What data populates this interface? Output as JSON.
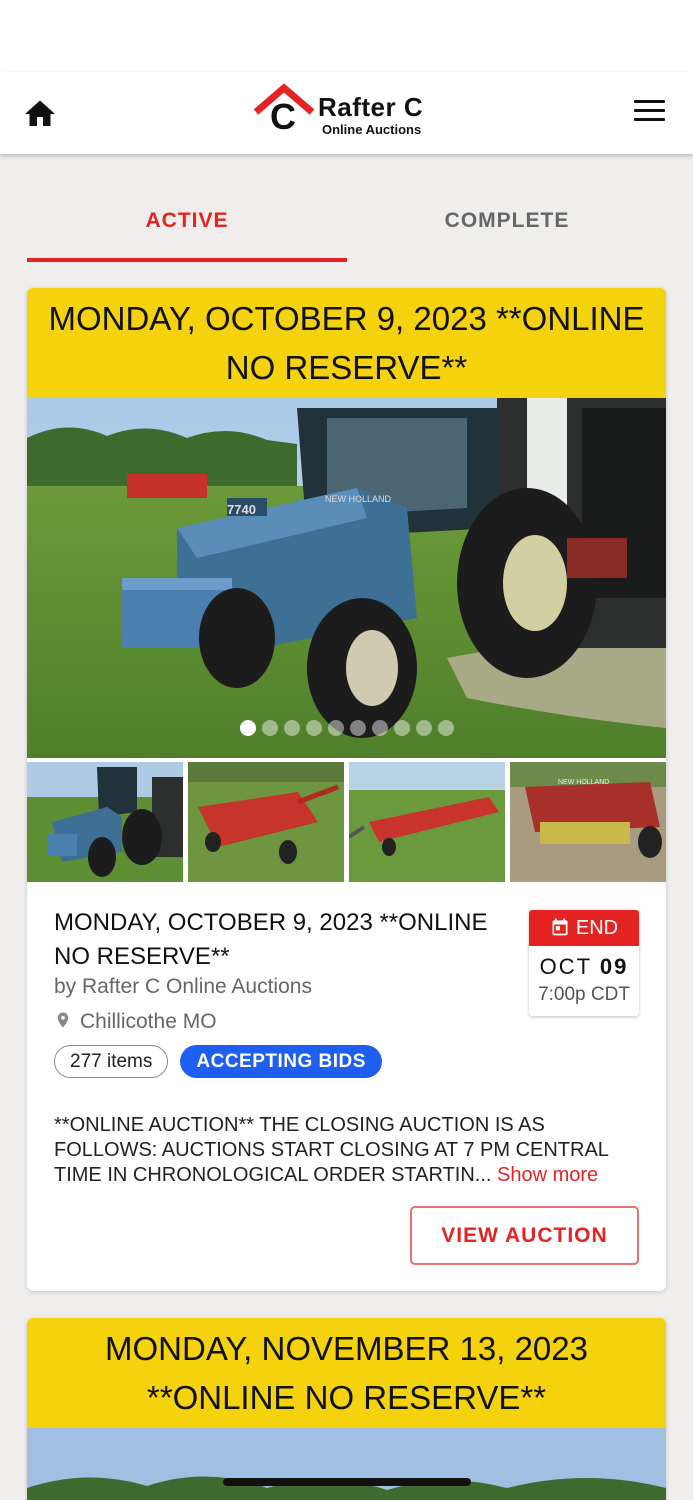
{
  "header": {
    "logo_title": "Rafter C",
    "logo_subtitle": "Online Auctions",
    "logo_letter": "C"
  },
  "tabs": [
    {
      "label": "ACTIVE",
      "active": true
    },
    {
      "label": "COMPLETE",
      "active": false
    }
  ],
  "auctions": [
    {
      "header_title": "MONDAY, OCTOBER 9, 2023 **ONLINE NO RESERVE**",
      "title": "MONDAY, OCTOBER 9, 2023 **ONLINE NO RESERVE**",
      "by": "by Rafter C Online Auctions",
      "location": "Chillicothe MO",
      "items_count": "277 items",
      "status": "ACCEPTING BIDS",
      "end_label": "END",
      "end_month": "OCT",
      "end_day": "09",
      "end_time": "7:00p CDT",
      "description": "**ONLINE AUCTION** THE CLOSING AUCTION IS AS FOLLOWS: AUCTIONS START CLOSING AT 7 PM CENTRAL TIME IN CHRONOLOGICAL ORDER STARTIN...",
      "show_more": "Show more",
      "view_button": "VIEW AUCTION",
      "carousel": {
        "current": 1,
        "total": 10
      },
      "tractor_badge": "7740",
      "tractor_brand": "NEW HOLLAND",
      "baler_brand": "NEW HOLLAND"
    },
    {
      "header_title": "MONDAY, NOVEMBER 13, 2023 **ONLINE NO RESERVE**"
    }
  ],
  "colors": {
    "accent": "#e52322",
    "header_yellow": "#f4d20d",
    "bids_blue": "#1f5ff0",
    "background": "#efeeec"
  }
}
